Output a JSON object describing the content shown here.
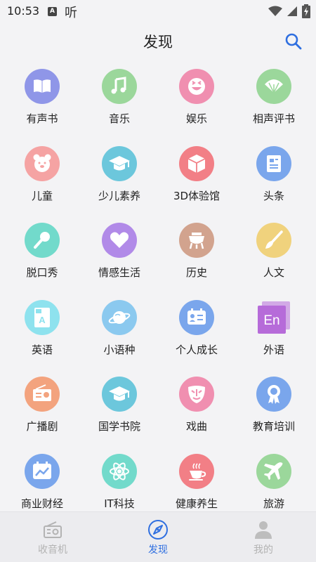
{
  "status_bar": {
    "time": "10:53",
    "indicator_letter": "A",
    "app_glyph": "听"
  },
  "header": {
    "title": "发现",
    "search_icon": "search-icon"
  },
  "colors": {
    "accent": "#2f6fe0",
    "inactive_tab": "#b3b3b3",
    "background": "#f3f3f5"
  },
  "categories": [
    {
      "label": "有声书",
      "icon": "book-icon",
      "color": "#8f96e8"
    },
    {
      "label": "音乐",
      "icon": "music-note-icon",
      "color": "#9bd79b"
    },
    {
      "label": "娱乐",
      "icon": "laughing-face-icon",
      "color": "#f08fb0"
    },
    {
      "label": "相声评书",
      "icon": "fan-icon",
      "color": "#9bd79b"
    },
    {
      "label": "儿童",
      "icon": "bear-icon",
      "color": "#f5a3a3"
    },
    {
      "label": "少儿素养",
      "icon": "graduation-cap-icon",
      "color": "#6cc7dc"
    },
    {
      "label": "3D体验馆",
      "icon": "cube-icon",
      "color": "#f27f86"
    },
    {
      "label": "头条",
      "icon": "news-icon",
      "color": "#7aa6ec"
    },
    {
      "label": "脱口秀",
      "icon": "microphone-icon",
      "color": "#72dacb"
    },
    {
      "label": "情感生活",
      "icon": "heart-icon",
      "color": "#b18ae8"
    },
    {
      "label": "历史",
      "icon": "ancient-vessel-icon",
      "color": "#d2a38e"
    },
    {
      "label": "人文",
      "icon": "brush-icon",
      "color": "#f0d27d"
    },
    {
      "label": "英语",
      "icon": "letter-a-card-icon",
      "color": "#8ee2ee"
    },
    {
      "label": "小语种",
      "icon": "planet-icon",
      "color": "#8bc9ef"
    },
    {
      "label": "个人成长",
      "icon": "id-card-icon",
      "color": "#7aa6ec"
    },
    {
      "label": "外语",
      "icon": "en-badge-icon",
      "color": "#b66bd9",
      "badge_text": "En"
    },
    {
      "label": "广播剧",
      "icon": "radio-icon",
      "color": "#f3a37e"
    },
    {
      "label": "国学书院",
      "icon": "graduation-cap-icon",
      "color": "#6cc7dc"
    },
    {
      "label": "戏曲",
      "icon": "opera-mask-icon",
      "color": "#f08fb0"
    },
    {
      "label": "教育培训",
      "icon": "award-ribbon-icon",
      "color": "#7aa6ec"
    },
    {
      "label": "商业财经",
      "icon": "chart-calendar-icon",
      "color": "#7aa6ec"
    },
    {
      "label": "IT科技",
      "icon": "atom-icon",
      "color": "#72dacb"
    },
    {
      "label": "健康养生",
      "icon": "tea-cup-icon",
      "color": "#f27f86"
    },
    {
      "label": "旅游",
      "icon": "airplane-icon",
      "color": "#9bd79b"
    }
  ],
  "tabs": [
    {
      "label": "收音机",
      "icon": "radio-outline-icon",
      "active": false
    },
    {
      "label": "发现",
      "icon": "compass-icon",
      "active": true
    },
    {
      "label": "我的",
      "icon": "person-icon",
      "active": false
    }
  ]
}
